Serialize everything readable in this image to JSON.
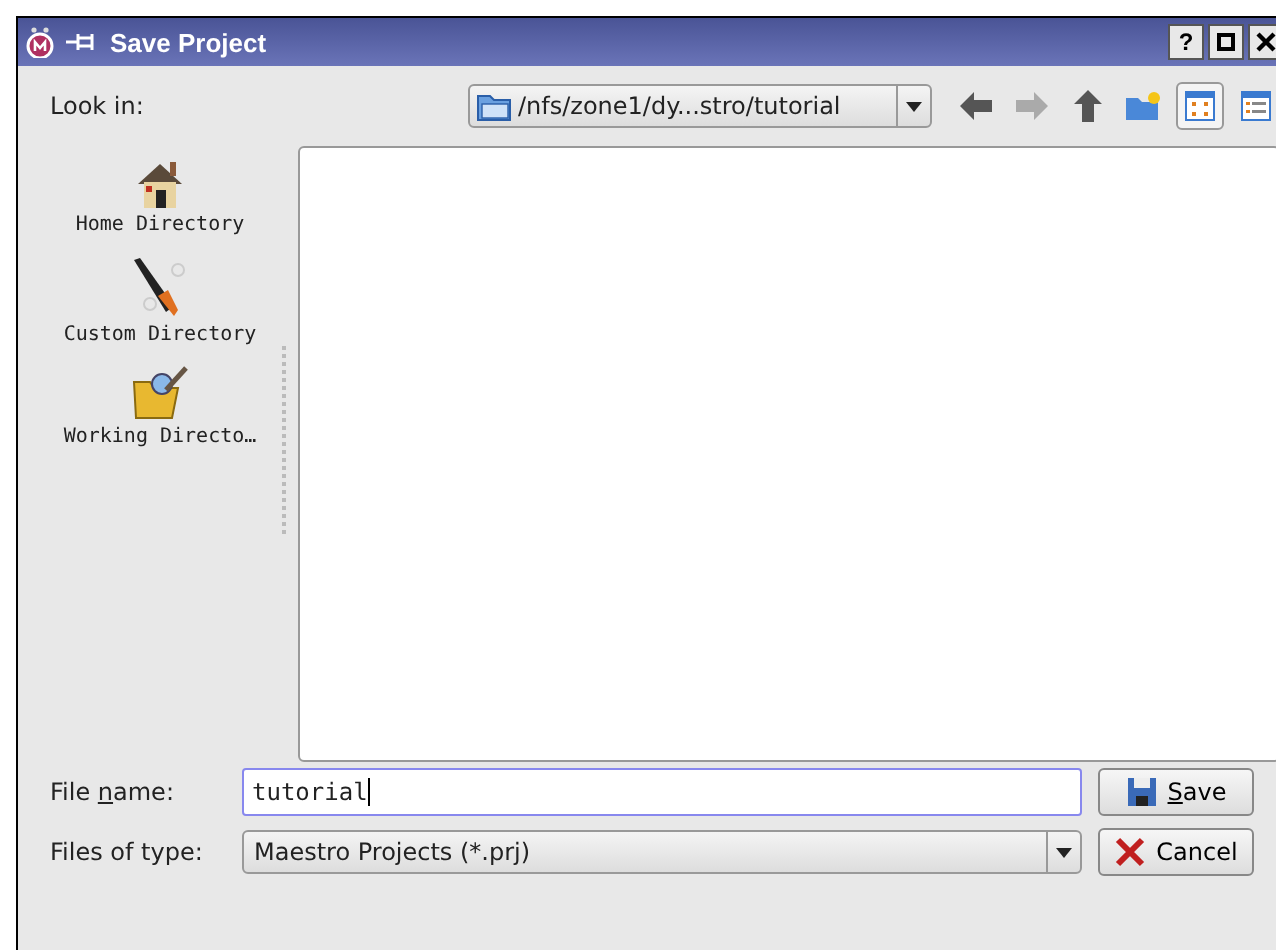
{
  "window": {
    "title": "Save Project",
    "help_button": "?"
  },
  "look_in": {
    "label": "Look in:",
    "path": "/nfs/zone1/dy...stro/tutorial"
  },
  "toolbar": [
    {
      "kind": "back",
      "disabled": false
    },
    {
      "kind": "forward",
      "disabled": true
    },
    {
      "kind": "up",
      "disabled": false
    },
    {
      "kind": "newfolder",
      "disabled": false
    },
    {
      "kind": "icons",
      "selected": true
    },
    {
      "kind": "details",
      "selected": false
    }
  ],
  "places": [
    {
      "kind": "home",
      "label": "Home Directory"
    },
    {
      "kind": "custom",
      "label": "Custom Directory"
    },
    {
      "kind": "working",
      "label": "Working Directo…"
    }
  ],
  "file_name": {
    "label_parts": [
      "File ",
      "n",
      "ame:"
    ],
    "value": "tutorial"
  },
  "file_type": {
    "label": "Files of type:",
    "value": "Maestro Projects (*.prj)"
  },
  "buttons": [
    {
      "kind": "save",
      "label_parts": [
        "S",
        "ave"
      ]
    },
    {
      "kind": "cancel",
      "label_parts": [
        "Cancel"
      ]
    }
  ]
}
